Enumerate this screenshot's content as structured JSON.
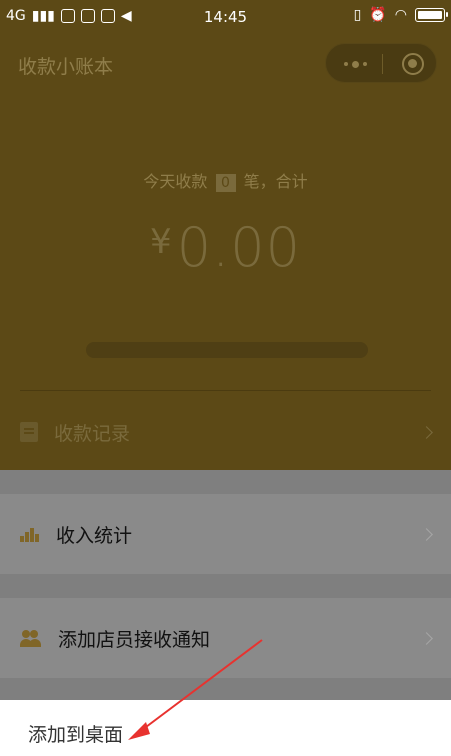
{
  "status_bar": {
    "network": "4G",
    "time": "14:45"
  },
  "header": {
    "title": "收款小账本",
    "summary_prefix": "今天收款",
    "count": "0",
    "summary_suffix": "笔，合计",
    "currency": "¥",
    "amount": "0.00",
    "progress_fraction": 0
  },
  "menu": {
    "records_label": "收款记录",
    "stats_label": "收入统计",
    "notify_label": "添加店员接收通知"
  },
  "sheet": {
    "add_to_desktop": "添加到桌面"
  },
  "colors": {
    "header_bg": "#5c4916",
    "overlay_gray": "#7f7f7f",
    "annotation_arrow": "#e8322f"
  },
  "icons": {
    "close": "target-circle-icon",
    "more": "more-dots-icon",
    "records": "document-icon",
    "stats": "bar-chart-icon",
    "notify": "users-icon"
  }
}
